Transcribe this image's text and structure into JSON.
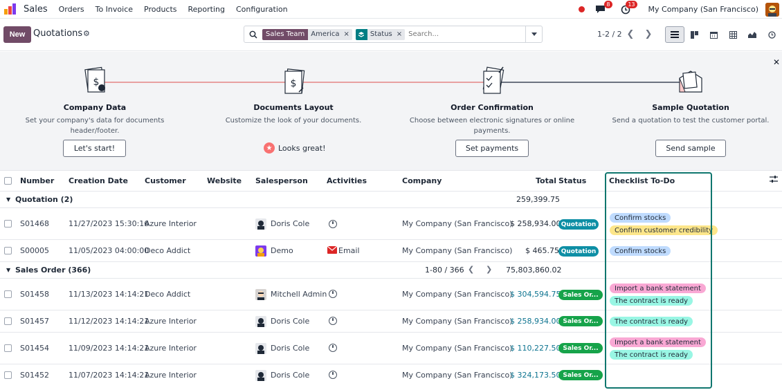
{
  "navbar": {
    "app_name": "Sales",
    "menu": [
      "Orders",
      "To Invoice",
      "Products",
      "Reporting",
      "Configuration"
    ],
    "messages_count": "8",
    "activities_count": "13",
    "company": "My Company (San Francisco)"
  },
  "control": {
    "new_label": "New",
    "title": "Quotations",
    "facets": [
      {
        "label": "Sales Team",
        "value": "America"
      },
      {
        "label": "",
        "value": "Status"
      }
    ],
    "search_placeholder": "Search...",
    "pager": "1-2 / 2"
  },
  "onboarding": {
    "steps": [
      {
        "title": "Company Data",
        "desc": "Set your company's data for documents header/footer.",
        "button": "Let's start!"
      },
      {
        "title": "Documents Layout",
        "desc": "Customize the look of your documents.",
        "done": "Looks great!"
      },
      {
        "title": "Order Confirmation",
        "desc": "Choose between electronic signatures or online payments.",
        "button": "Set payments"
      },
      {
        "title": "Sample Quotation",
        "desc": "Send a quotation to test the customer portal.",
        "button": "Send sample"
      }
    ]
  },
  "table": {
    "headers": {
      "number": "Number",
      "creation_date": "Creation Date",
      "customer": "Customer",
      "website": "Website",
      "salesperson": "Salesperson",
      "activities": "Activities",
      "company": "Company",
      "total": "Total",
      "status": "Status",
      "checklist": "Checklist To-Do"
    },
    "groups": [
      {
        "label": "Quotation (2)",
        "total": "259,399.75",
        "rows": [
          {
            "number": "S01468",
            "date": "11/27/2023 15:30:16",
            "customer": "Azure Interior",
            "salesperson": "Doris Cole",
            "activity": "",
            "company": "My Company (San Francisco)",
            "total": "$ 258,934.00",
            "status": "Quotation",
            "tags": [
              "Confirm stocks",
              "Confirm customer credibility"
            ]
          },
          {
            "number": "S00005",
            "date": "11/05/2023 04:00:00",
            "customer": "Deco Addict",
            "salesperson": "Demo",
            "activity": "Email",
            "company": "My Company (San Francisco)",
            "total": "$ 465.75",
            "status": "Quotation",
            "tags": [
              "Confirm stocks"
            ]
          }
        ]
      },
      {
        "label": "Sales Order (366)",
        "pager": "1-80 / 366",
        "total": "75,803,860.02",
        "rows": [
          {
            "number": "S01458",
            "date": "11/13/2023 14:14:21",
            "customer": "Deco Addict",
            "salesperson": "Mitchell Admin",
            "activity": "",
            "company": "My Company (San Francisco)",
            "total": "$ 304,594.75",
            "status": "Sales Or...",
            "tags": [
              "Import a bank statement",
              "The contract is ready"
            ]
          },
          {
            "number": "S01457",
            "date": "11/12/2023 14:14:21",
            "customer": "Azure Interior",
            "salesperson": "Doris Cole",
            "activity": "",
            "company": "My Company (San Francisco)",
            "total": "$ 258,934.00",
            "status": "Sales Or...",
            "tags": [
              "The contract is ready"
            ]
          },
          {
            "number": "S01454",
            "date": "11/09/2023 14:14:21",
            "customer": "Azure Interior",
            "salesperson": "Doris Cole",
            "activity": "",
            "company": "My Company (San Francisco)",
            "total": "$ 110,227.50",
            "status": "Sales Or...",
            "tags": [
              "Import a bank statement",
              "The contract is ready"
            ]
          },
          {
            "number": "S01452",
            "date": "11/07/2023 14:14:21",
            "customer": "Azure Interior",
            "salesperson": "Doris Cole",
            "activity": "",
            "company": "My Company (San Francisco)",
            "total": "$ 324,173.50",
            "status": "Sales Or...",
            "tags": []
          }
        ]
      }
    ]
  },
  "colors": {
    "brand": "#714b67",
    "quotation_badge": "#0e8fa5",
    "sales_badge": "#16a34a",
    "tag_blue": "#bfdbfe",
    "tag_yellow": "#fde68a",
    "tag_pink": "#f9a8d4",
    "tag_teal": "#99f6e4",
    "highlight_frame": "#0f766e"
  }
}
